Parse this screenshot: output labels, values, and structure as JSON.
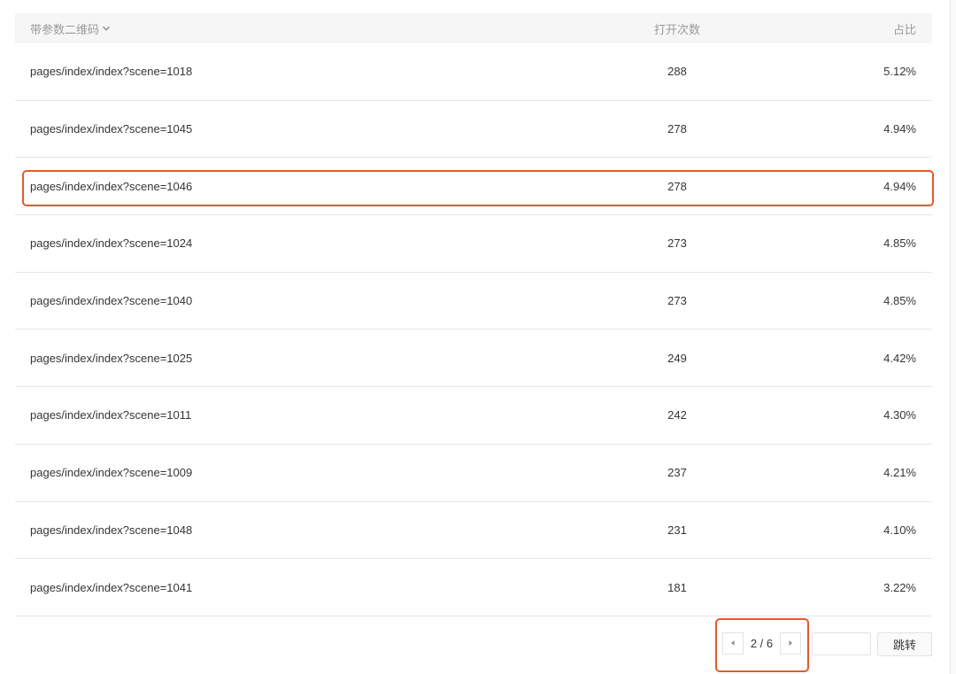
{
  "table": {
    "headers": {
      "name": "带参数二维码",
      "name_icon": "chevron-down-icon",
      "count": "打开次数",
      "ratio": "占比"
    },
    "rows": [
      {
        "name": "pages/index/index?scene=1018",
        "count": "288",
        "ratio": "5.12%"
      },
      {
        "name": "pages/index/index?scene=1045",
        "count": "278",
        "ratio": "4.94%"
      },
      {
        "name": "pages/index/index?scene=1046",
        "count": "278",
        "ratio": "4.94%"
      },
      {
        "name": "pages/index/index?scene=1024",
        "count": "273",
        "ratio": "4.85%"
      },
      {
        "name": "pages/index/index?scene=1040",
        "count": "273",
        "ratio": "4.85%"
      },
      {
        "name": "pages/index/index?scene=1025",
        "count": "249",
        "ratio": "4.42%"
      },
      {
        "name": "pages/index/index?scene=1011",
        "count": "242",
        "ratio": "4.30%"
      },
      {
        "name": "pages/index/index?scene=1009",
        "count": "237",
        "ratio": "4.21%"
      },
      {
        "name": "pages/index/index?scene=1048",
        "count": "231",
        "ratio": "4.10%"
      },
      {
        "name": "pages/index/index?scene=1041",
        "count": "181",
        "ratio": "3.22%"
      }
    ]
  },
  "pagination": {
    "page_text": "2 / 6",
    "prev_icon": "caret-left-icon",
    "next_icon": "caret-right-icon",
    "jump_value": "",
    "jump_label": "跳转"
  },
  "annotations": {
    "color": "#e35a2c"
  }
}
